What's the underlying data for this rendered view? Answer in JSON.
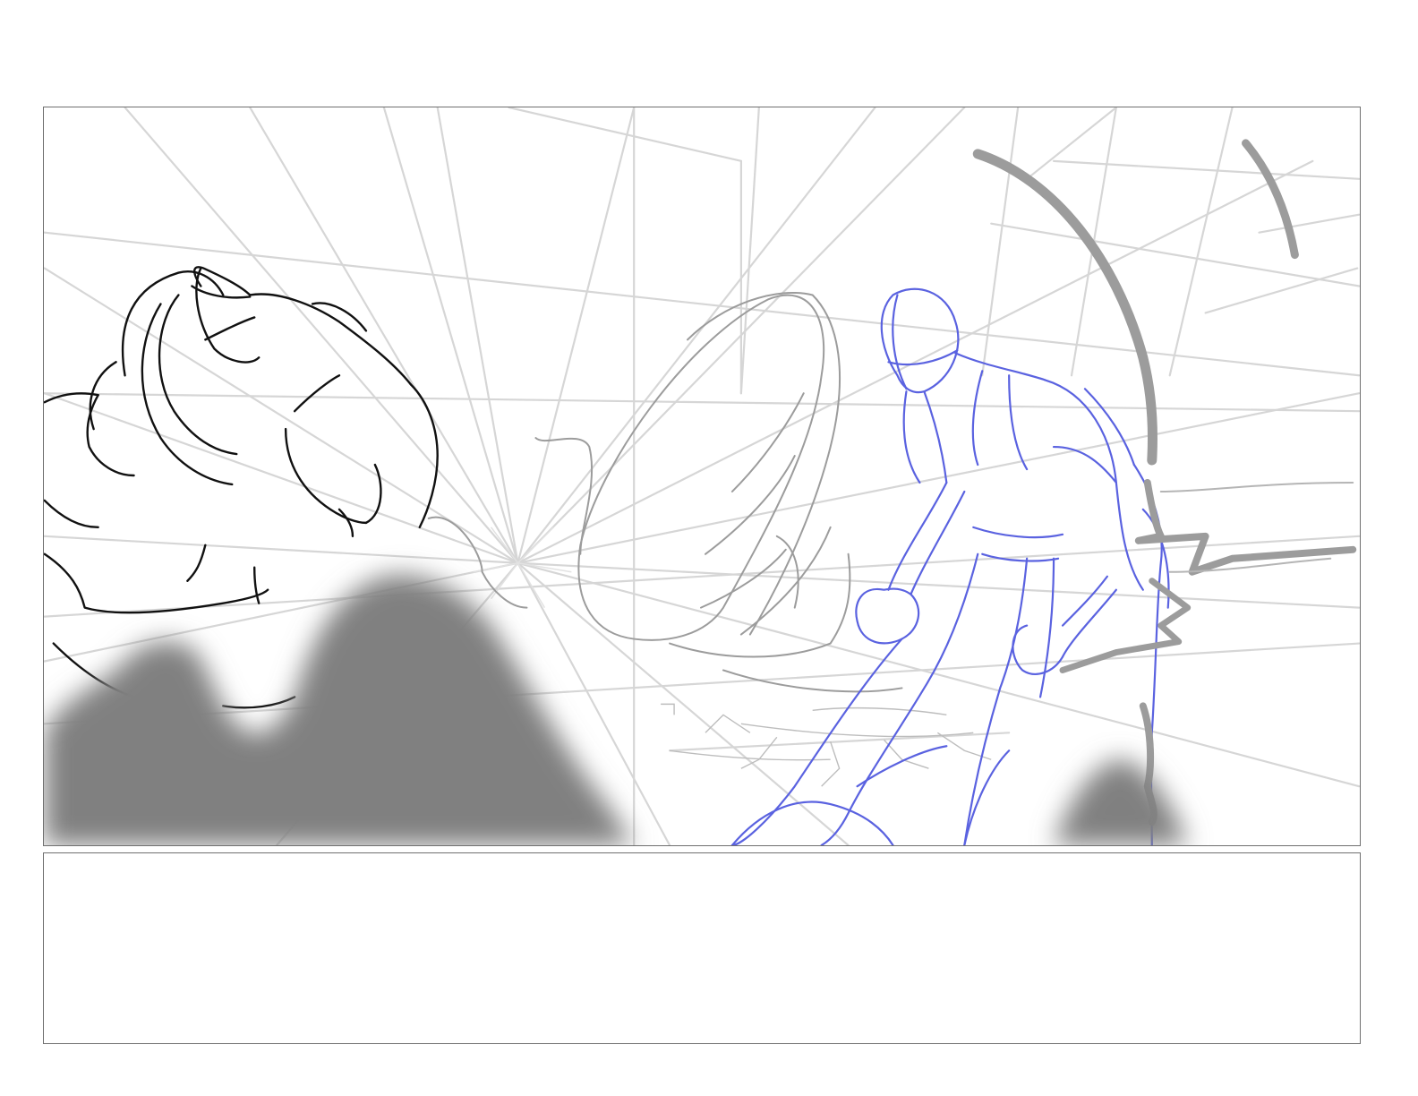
{
  "storyboard": {
    "frame": {
      "subject": [
        "giant-fist",
        "boulder",
        "hero-figure",
        "impact-burst",
        "floor-cracks"
      ],
      "ink_colors": {
        "construction_lines": "#d2d2d2",
        "fist_ink": "#111111",
        "boulder_ink": "#9a9a9a",
        "hero_ink": "#5a62e0",
        "fg_smudge": "#808080",
        "motion_lines": "#9c9c9c"
      }
    },
    "notes": {
      "text": ""
    }
  }
}
